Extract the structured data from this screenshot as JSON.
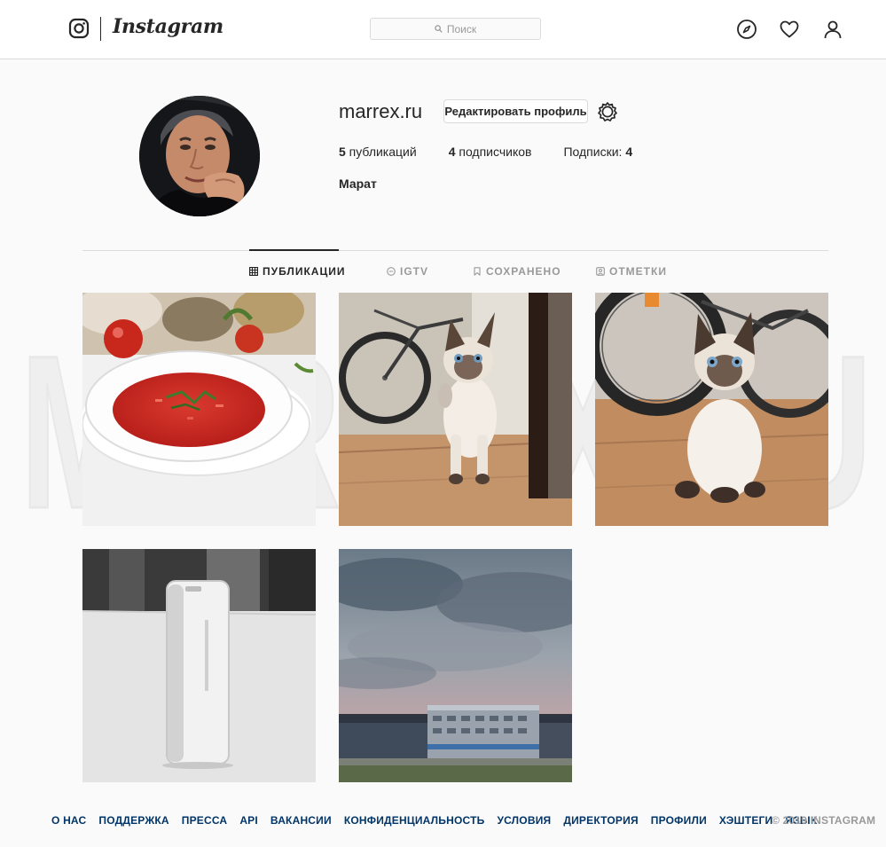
{
  "header": {
    "logo_text": "Instagram",
    "search_placeholder": "Поиск"
  },
  "profile": {
    "username": "marrex.ru",
    "edit_button_label": "Редактировать профиль",
    "stats": [
      {
        "count": "5",
        "label": " публикаций"
      },
      {
        "count": "4",
        "label": " подписчиков"
      },
      {
        "label": "Подписки: ",
        "count": "4"
      }
    ],
    "full_name": "Марат"
  },
  "tabs": [
    {
      "label": "ПУБЛИКАЦИИ",
      "icon": "grid-icon",
      "active": true
    },
    {
      "label": "IGTV",
      "icon": "igtv-icon",
      "active": false
    },
    {
      "label": "СОХРАНЕНО",
      "icon": "bookmark-icon",
      "active": false
    },
    {
      "label": "ОТМЕТКИ",
      "icon": "tagged-icon",
      "active": false
    }
  ],
  "posts": [
    {
      "subject": "borscht-soup"
    },
    {
      "subject": "siamese-kitten-walking"
    },
    {
      "subject": "siamese-kitten-sitting"
    },
    {
      "subject": "power-bank"
    },
    {
      "subject": "sunset-building"
    }
  ],
  "watermark_text": "MARREX.RU",
  "footer": {
    "links": [
      "О НАС",
      "ПОДДЕРЖКА",
      "ПРЕССА",
      "API",
      "ВАКАНСИИ",
      "КОНФИДЕНЦИАЛЬНОСТЬ",
      "УСЛОВИЯ",
      "ДИРЕКТОРИЯ",
      "ПРОФИЛИ",
      "ХЭШТЕГИ",
      "ЯЗЫК"
    ],
    "copyright": "© 2019 INSTAGRAM"
  },
  "colors": {
    "background": "#fafafa",
    "text": "#262626",
    "muted": "#999999",
    "link": "#003569",
    "border": "#dbdbdb"
  }
}
